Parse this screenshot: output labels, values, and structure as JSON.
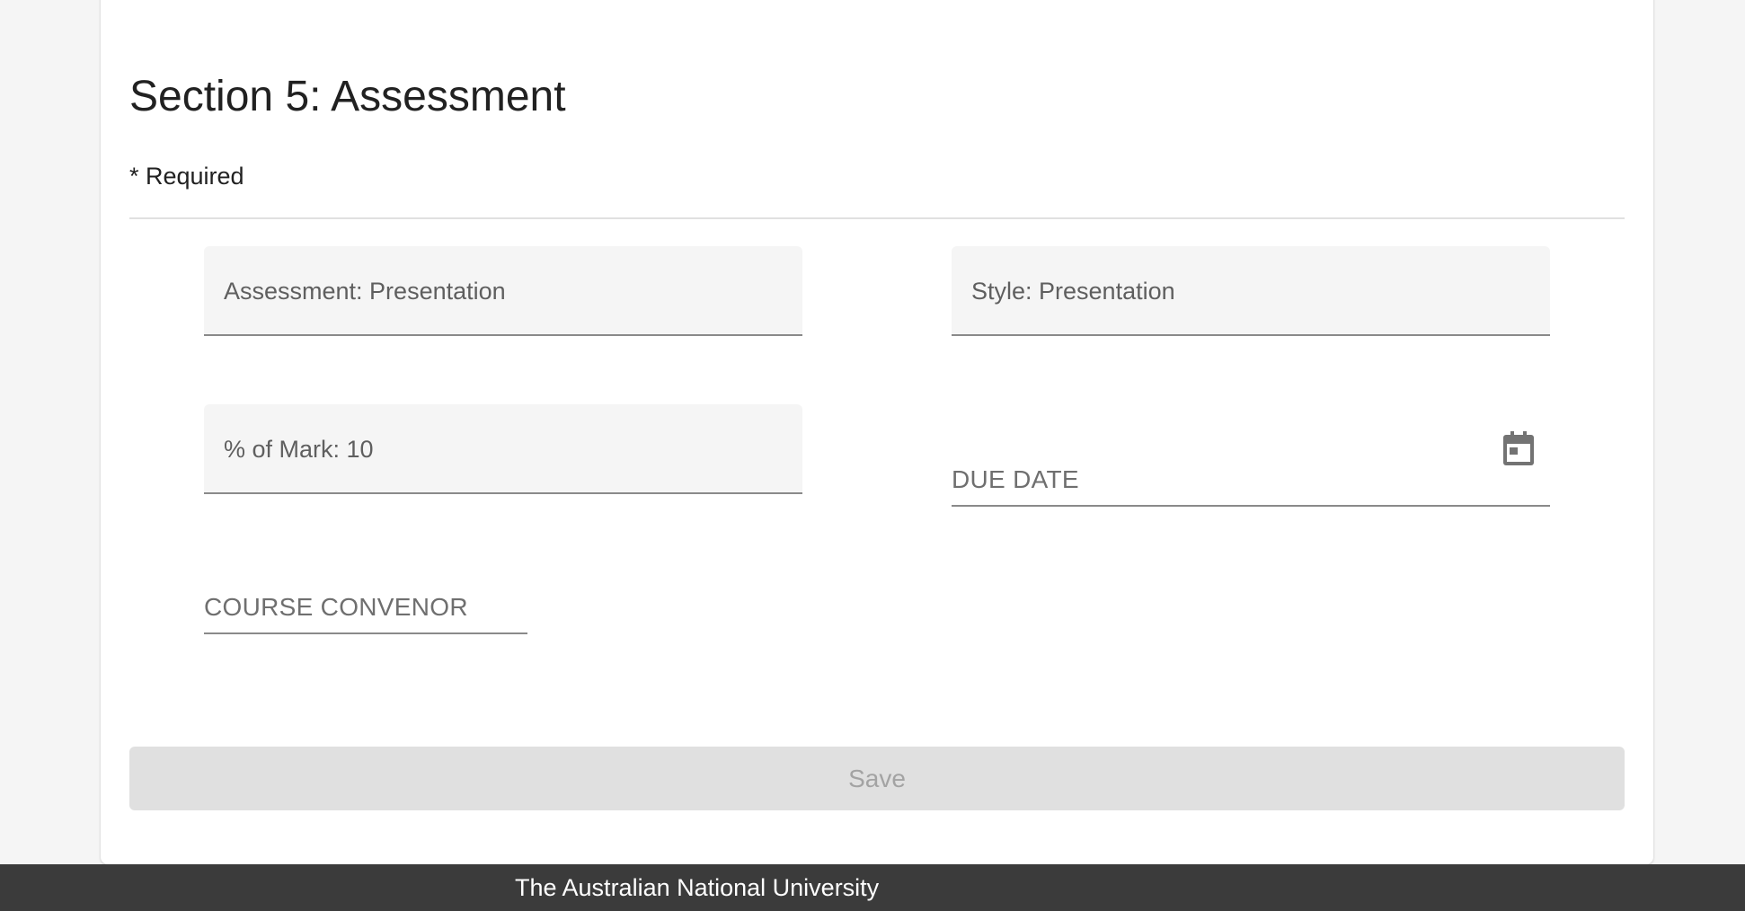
{
  "section": {
    "title": "Section 5: Assessment",
    "required_note": "* Required"
  },
  "fields": {
    "assessment": {
      "value": "Assessment: Presentation"
    },
    "style": {
      "value": "Style: Presentation"
    },
    "percent_of_mark": {
      "value": "% of Mark: 10"
    },
    "due_date": {
      "label": "DUE DATE",
      "icon": "calendar-icon"
    },
    "course_convenor": {
      "label": "COURSE CONVENOR"
    }
  },
  "actions": {
    "save_label": "Save"
  },
  "footer": {
    "text": "The Australian National University"
  },
  "colors": {
    "page_background": "#f5f5f5",
    "card_background": "#ffffff",
    "field_fill": "#f5f5f5",
    "button_disabled": "#e0e0e0",
    "footer_background": "#3b3b3b"
  }
}
